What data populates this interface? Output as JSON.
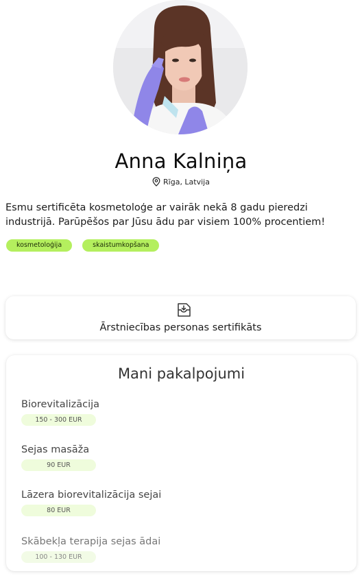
{
  "profile": {
    "name": "Anna Kalniņa",
    "location": "Rīga, Latvija",
    "bio": "Esmu sertificēta kosmetoloģe ar vairāk nekā 8 gadu pieredzi industrijā. Parūpēšos par Jūsu ādu par visiem 100% procentiem!",
    "tags": [
      "kosmetoloģija",
      "skaistumkopšana"
    ]
  },
  "certificate": {
    "label": "Ārstniecības personas sertifikāts",
    "icon": "document-download-icon"
  },
  "services": {
    "title": "Mani pakalpojumi",
    "items": [
      {
        "name": "Biorevitalizācija",
        "price": "150 - 300 EUR"
      },
      {
        "name": "Sejas masāža",
        "price": "90 EUR"
      },
      {
        "name": "Lāzera biorevitalizācija sejai",
        "price": "80 EUR"
      },
      {
        "name": "Skābekļa terapija sejas ādai",
        "price": "100 - 130 EUR"
      }
    ]
  },
  "colors": {
    "tag_bg": "#b4ef5e",
    "price_bg": "#effcdc",
    "glove": "#8f86e8"
  }
}
